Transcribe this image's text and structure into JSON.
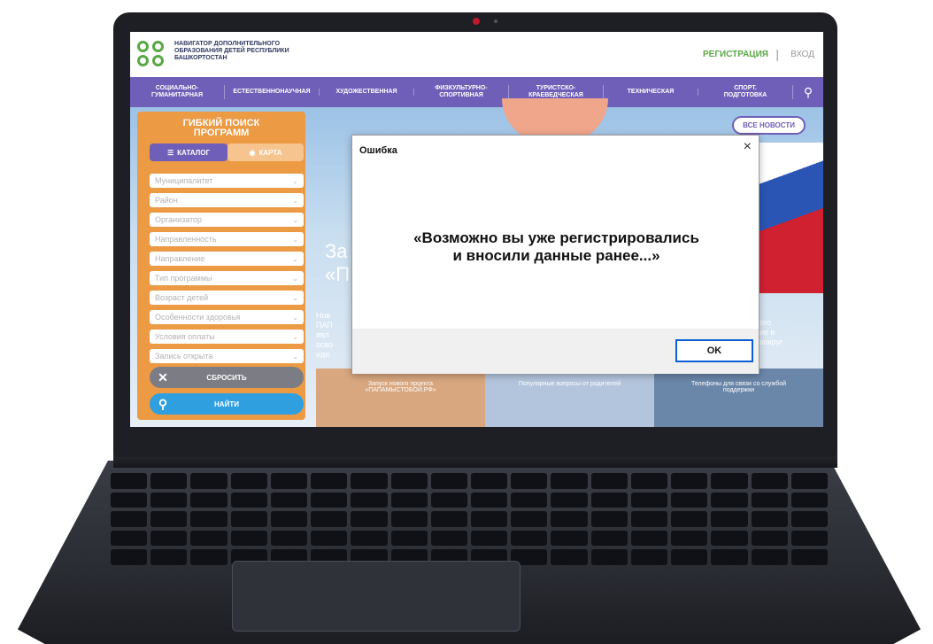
{
  "header": {
    "logo_text": [
      "НАВИГАТОР ДОПОЛНИТЕЛЬНОГО",
      "ОБРАЗОВАНИЯ ДЕТЕЙ РЕСПУБЛИКИ",
      "БАШКОРТОСТАН"
    ],
    "register_label": "РЕГИСТРАЦИЯ",
    "separator": "|",
    "login_label": "ВХОД"
  },
  "nav": {
    "items": [
      "СОЦИАЛЬНО-\nГУМАНИТАРНАЯ",
      "ЕСТЕСТВЕННОНАУЧНАЯ",
      "ХУДОЖЕСТВЕННАЯ",
      "ФИЗКУЛЬТУРНО-\nСПОРТИВНАЯ",
      "ТУРИСТСКО-\nКРАЕВЕДЧЕСКАЯ",
      "ТЕХНИЧЕСКАЯ",
      "СПОРТ.\nПОДГОТОВКА"
    ]
  },
  "filter_panel": {
    "title": "ГИБКИЙ ПОИСК ПРОГРАММ",
    "tab_catalog": "КАТАЛОГ",
    "tab_map": "КАРТА",
    "filters": [
      "Муниципалитет",
      "Район",
      "Организатор",
      "Направленность",
      "Направление",
      "Тип программы",
      "Возраст детей",
      "Особенности здоровья",
      "Условия оплаты",
      "Запись открыта"
    ],
    "reset_label": "СБРОСИТЬ",
    "find_label": "НАЙТИ"
  },
  "hero": {
    "all_news_label": "ВСЕ НОВОСТИ",
    "title_fragment": "За\n«П",
    "blurb_fragment": "Нов\nПАП\nявл\nосво\nиде",
    "blurb_right_fragment": "ого\nие в\nвокруг",
    "cards": [
      "Запуск нового проекта\n«ПАПАМЫСТОБОЙ.РФ»",
      "Популярные вопросы от родителей",
      "Телефоны для связи со службой\nподдержки"
    ]
  },
  "dialog": {
    "title": "Ошибка",
    "close_label": "×",
    "message": "«Возможно вы уже регистрировались\nи вносили данные ранее...»",
    "ok_label": "OK"
  },
  "colors": {
    "accent_purple": "#6f5fb8",
    "panel_orange": "#ec9a44",
    "brand_green": "#5aa845",
    "find_blue": "#2f9fe0",
    "ok_border_blue": "#0a5fd6"
  }
}
